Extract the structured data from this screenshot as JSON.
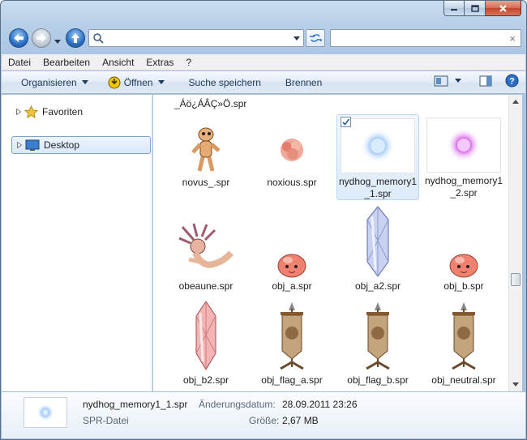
{
  "window": {
    "caption_buttons": [
      "minimize-icon",
      "maximize-icon",
      "close-icon"
    ]
  },
  "address_bar": {
    "value": "",
    "placeholder": ""
  },
  "search_box": {
    "value": "",
    "clear_glyph": "×"
  },
  "menu": [
    "Datei",
    "Bearbeiten",
    "Ansicht",
    "Extras",
    "?"
  ],
  "commands": {
    "organize": "Organisieren",
    "open": "Öffnen",
    "save_search": "Suche speichern",
    "burn": "Brennen"
  },
  "nav_pane": {
    "favorites": "Favoriten",
    "desktop": "Desktop"
  },
  "files": {
    "partial_top": "_Áö¿ÁÂÇ»Ö.spr",
    "items": [
      {
        "name": "novus_.spr",
        "icon": "sprite-novus"
      },
      {
        "name": "noxious.spr",
        "icon": "sprite-noxious"
      },
      {
        "name": "nydhog_memory1_1.spr",
        "icon": "sprite-blue-orb",
        "selected": true
      },
      {
        "name": "nydhog_memory1_2.spr",
        "icon": "sprite-purple-orb"
      },
      {
        "name": "obeaune.spr",
        "icon": "sprite-obeaune"
      },
      {
        "name": "obj_a.spr",
        "icon": "sprite-pink-blob"
      },
      {
        "name": "obj_a2.spr",
        "icon": "sprite-blue-crystal"
      },
      {
        "name": "obj_b.spr",
        "icon": "sprite-pink-blob"
      },
      {
        "name": "obj_b2.spr",
        "icon": "sprite-pink-crystal"
      },
      {
        "name": "obj_flag_a.spr",
        "icon": "sprite-banner"
      },
      {
        "name": "obj_flag_b.spr",
        "icon": "sprite-banner"
      },
      {
        "name": "obj_neutral.spr",
        "icon": "sprite-banner"
      }
    ]
  },
  "details": {
    "name": "nydhog_memory1_1.spr",
    "type": "SPR-Datei",
    "modified_label": "Änderungsdatum:",
    "modified_value": "28.09.2011 23:26",
    "size_label": "Größe:",
    "size_value": "2,67 MB"
  },
  "colors": {
    "accent": "#2b6fc4",
    "selection": "#ddebfa"
  }
}
